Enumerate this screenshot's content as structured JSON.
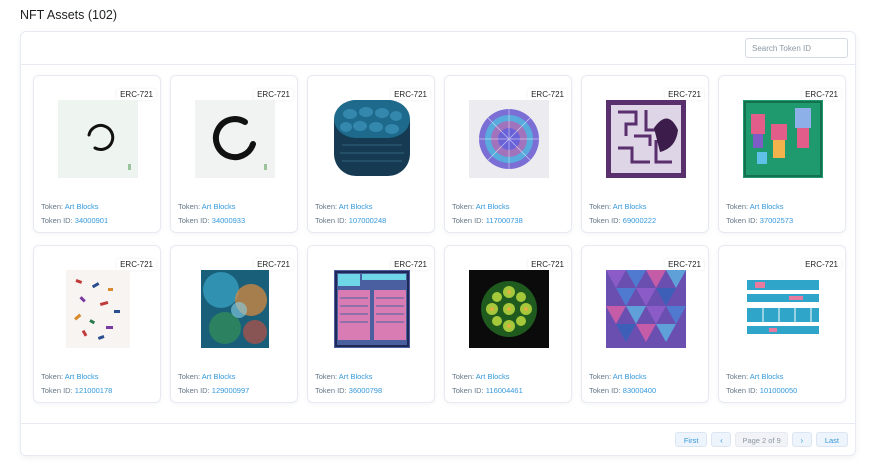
{
  "page": {
    "title": "NFT Assets (102)"
  },
  "search": {
    "placeholder": "Search Token ID"
  },
  "nfts": [
    {
      "standard": "ERC-721",
      "token_label": "Token:",
      "token_name": "Art Blocks",
      "id_label": "Token ID:",
      "token_id": "34000901",
      "art": "ring-thin-icon"
    },
    {
      "standard": "ERC-721",
      "token_label": "Token:",
      "token_name": "Art Blocks",
      "id_label": "Token ID:",
      "token_id": "34000933",
      "art": "ring-thick-icon"
    },
    {
      "standard": "ERC-721",
      "token_label": "Token:",
      "token_name": "Art Blocks",
      "id_label": "Token ID:",
      "token_id": "107000248",
      "art": "blue-cells-icon"
    },
    {
      "standard": "ERC-721",
      "token_label": "Token:",
      "token_name": "Art Blocks",
      "id_label": "Token ID:",
      "token_id": "117000738",
      "art": "mandala-icon"
    },
    {
      "standard": "ERC-721",
      "token_label": "Token:",
      "token_name": "Art Blocks",
      "id_label": "Token ID:",
      "token_id": "69000222",
      "art": "purple-maze-icon"
    },
    {
      "standard": "ERC-721",
      "token_label": "Token:",
      "token_name": "Art Blocks",
      "id_label": "Token ID:",
      "token_id": "37002573",
      "art": "green-robots-icon"
    },
    {
      "standard": "ERC-721",
      "token_label": "Token:",
      "token_name": "Art Blocks",
      "id_label": "Token ID:",
      "token_id": "121000178",
      "art": "confetti-icon"
    },
    {
      "standard": "ERC-721",
      "token_label": "Token:",
      "token_name": "Art Blocks",
      "id_label": "Token ID:",
      "token_id": "129000997",
      "art": "teal-blur-icon"
    },
    {
      "standard": "ERC-721",
      "token_label": "Token:",
      "token_name": "Art Blocks",
      "id_label": "Token ID:",
      "token_id": "36000798",
      "art": "pink-panels-icon"
    },
    {
      "standard": "ERC-721",
      "token_label": "Token:",
      "token_name": "Art Blocks",
      "id_label": "Token ID:",
      "token_id": "116004461",
      "art": "green-flower-icon"
    },
    {
      "standard": "ERC-721",
      "token_label": "Token:",
      "token_name": "Art Blocks",
      "id_label": "Token ID:",
      "token_id": "83000400",
      "art": "hex-mosaic-icon"
    },
    {
      "standard": "ERC-721",
      "token_label": "Token:",
      "token_name": "Art Blocks",
      "id_label": "Token ID:",
      "token_id": "101000050",
      "art": "cyan-grid-icon"
    }
  ],
  "pagination": {
    "first": "First",
    "prev": "‹",
    "info": "Page 2 of 9",
    "next": "›",
    "last": "Last"
  },
  "colors": {
    "link": "#3498db",
    "muted": "#677788",
    "border": "#e7eaf3"
  }
}
